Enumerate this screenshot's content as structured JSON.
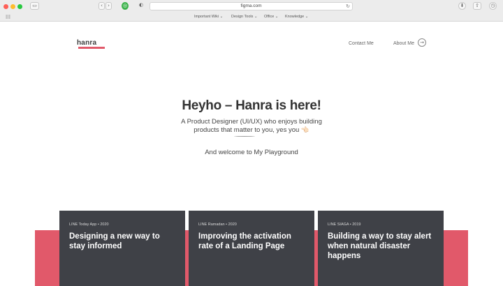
{
  "browser": {
    "url": "figma.com",
    "nav_back": "‹",
    "nav_forward": "›",
    "reload": "↻",
    "bookmarks": [
      {
        "label": "Important Wiki ⌄"
      },
      {
        "label": "Design Tools ⌄"
      },
      {
        "label": "Office ⌄"
      },
      {
        "label": "Knowledge ⌄"
      }
    ]
  },
  "header": {
    "logo": "hanra",
    "contact_label": "Contact Me",
    "about_label": "About Me",
    "about_arrow": "→"
  },
  "hero": {
    "title": "Heyho – Hanra is here!",
    "subtitle_line1": "A Product Designer (UI/UX) who enjoys building",
    "subtitle_line2": "products that matter to you, yes you 👈🏻",
    "welcome": "And welcome to My Playground"
  },
  "cards": [
    {
      "tag": "LINE Today App • 2020",
      "title": "Designing a new way to stay informed"
    },
    {
      "tag": "LINE Ramadan • 2020",
      "title": "Improving the activation rate of a Landing Page"
    },
    {
      "tag": "LINE SIAGA • 2019",
      "title": "Building a way to stay alert when natural disaster happens"
    }
  ],
  "colors": {
    "accent": "#e1596a",
    "card_bg": "#3f4147"
  }
}
